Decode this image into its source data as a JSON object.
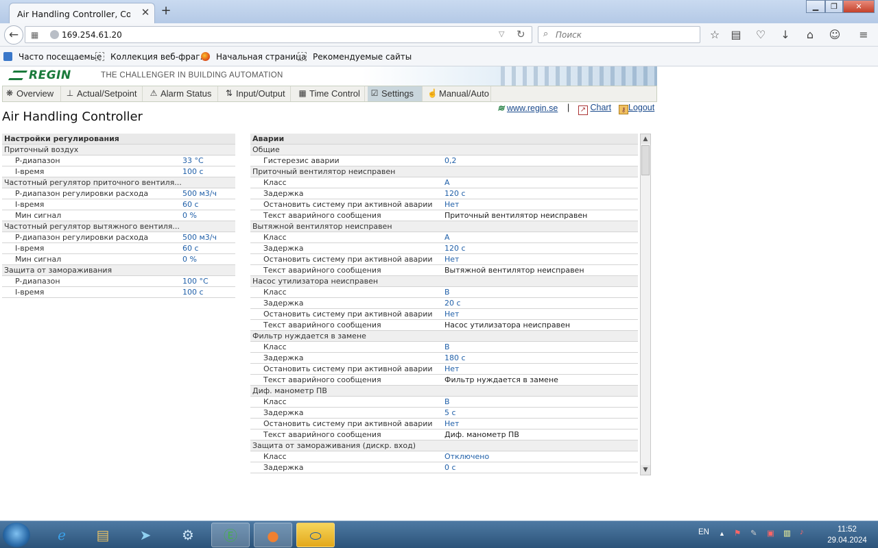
{
  "browser": {
    "tab_title": "Air Handling Controller, Corrig...",
    "tab_close": "✕",
    "new_tab": "+",
    "url": "169.254.61.20",
    "search_placeholder": "Поиск",
    "bookmarks": [
      "Часто посещаемые",
      "Коллекция веб-фраг...",
      "Начальная страница",
      "Рекомендуемые сайты"
    ]
  },
  "header": {
    "logo": "REGIN",
    "slogan": "THE CHALLENGER IN BUILDING AUTOMATION"
  },
  "menu": [
    {
      "label": "Overview",
      "icon": "overview-icon"
    },
    {
      "label": "Actual/Setpoint",
      "icon": "setpoint-icon"
    },
    {
      "label": "Alarm Status",
      "icon": "alarm-icon"
    },
    {
      "label": "Input/Output",
      "icon": "io-icon"
    },
    {
      "label": "Time Control",
      "icon": "calendar-icon"
    },
    {
      "label": "Settings",
      "icon": "settings-icon",
      "active": true
    },
    {
      "label": "Manual/Auto",
      "icon": "hand-icon"
    }
  ],
  "links": {
    "site": "www.regin.se",
    "separator": "|",
    "chart": "Chart",
    "logout": "Logout"
  },
  "page_title": "Air Handling Controller",
  "left_table": {
    "header": "Настройки регулирования",
    "rows": [
      {
        "type": "group",
        "label": "Приточный воздух"
      },
      {
        "type": "item",
        "label": "P-диапазон",
        "value": "33 °C"
      },
      {
        "type": "item",
        "label": "I-время",
        "value": "100 с"
      },
      {
        "type": "group",
        "label": "Частотный регулятор приточного вентиля..."
      },
      {
        "type": "item",
        "label": "P-диапазон регулировки расхода",
        "value": "500 м3/ч"
      },
      {
        "type": "item",
        "label": "I-время",
        "value": "60 с"
      },
      {
        "type": "item",
        "label": "Мин сигнал",
        "value": "0 %"
      },
      {
        "type": "group",
        "label": "Частотный регулятор вытяжного вентиля..."
      },
      {
        "type": "item",
        "label": "P-диапазон регулировки расхода",
        "value": "500 м3/ч"
      },
      {
        "type": "item",
        "label": "I-время",
        "value": "60 с"
      },
      {
        "type": "item",
        "label": "Мин сигнал",
        "value": "0 %"
      },
      {
        "type": "group",
        "label": "Защита от замораживания"
      },
      {
        "type": "item",
        "label": "P-диапазон",
        "value": "100 °C"
      },
      {
        "type": "item",
        "label": "I-время",
        "value": "100 с"
      }
    ]
  },
  "right_table": {
    "header": "Аварии",
    "rows": [
      {
        "type": "group",
        "label": "Общие"
      },
      {
        "type": "item",
        "label": "Гистерезис аварии",
        "value": "0,2"
      },
      {
        "type": "group",
        "label": "Приточный вентилятор неисправен"
      },
      {
        "type": "item",
        "label": "Класс",
        "value": "A"
      },
      {
        "type": "item",
        "label": "Задержка",
        "value": "120 с"
      },
      {
        "type": "item",
        "label": "Остановить систему при активной аварии",
        "value": "Нет"
      },
      {
        "type": "text",
        "label": "Текст аварийного сообщения",
        "value": "Приточный вентилятор неисправен"
      },
      {
        "type": "group",
        "label": "Вытяжной вентилятор неисправен"
      },
      {
        "type": "item",
        "label": "Класс",
        "value": "A"
      },
      {
        "type": "item",
        "label": "Задержка",
        "value": "120 с"
      },
      {
        "type": "item",
        "label": "Остановить систему при активной аварии",
        "value": "Нет"
      },
      {
        "type": "text",
        "label": "Текст аварийного сообщения",
        "value": "Вытяжной вентилятор неисправен"
      },
      {
        "type": "group",
        "label": "Насос утилизатора неисправен"
      },
      {
        "type": "item",
        "label": "Класс",
        "value": "B"
      },
      {
        "type": "item",
        "label": "Задержка",
        "value": "20 с"
      },
      {
        "type": "item",
        "label": "Остановить систему при активной аварии",
        "value": "Нет"
      },
      {
        "type": "text",
        "label": "Текст аварийного сообщения",
        "value": "Насос утилизатора неисправен"
      },
      {
        "type": "group",
        "label": "Фильтр нуждается в замене"
      },
      {
        "type": "item",
        "label": "Класс",
        "value": "B"
      },
      {
        "type": "item",
        "label": "Задержка",
        "value": "180 с"
      },
      {
        "type": "item",
        "label": "Остановить систему при активной аварии",
        "value": "Нет"
      },
      {
        "type": "text",
        "label": "Текст аварийного сообщения",
        "value": "Фильтр нуждается в замене"
      },
      {
        "type": "group",
        "label": "Диф. манометр ПВ"
      },
      {
        "type": "item",
        "label": "Класс",
        "value": "B"
      },
      {
        "type": "item",
        "label": "Задержка",
        "value": "5 с"
      },
      {
        "type": "item",
        "label": "Остановить систему при активной аварии",
        "value": "Нет"
      },
      {
        "type": "text",
        "label": "Текст аварийного сообщения",
        "value": "Диф. манометр ПВ"
      },
      {
        "type": "group",
        "label": "Защита от замораживания (дискр. вход)"
      },
      {
        "type": "item",
        "label": "Класс",
        "value": "Отключено"
      },
      {
        "type": "item",
        "label": "Задержка",
        "value": "0 с"
      }
    ]
  },
  "taskbar": {
    "lang": "EN",
    "time": "11:52",
    "date": "29.04.2024"
  }
}
